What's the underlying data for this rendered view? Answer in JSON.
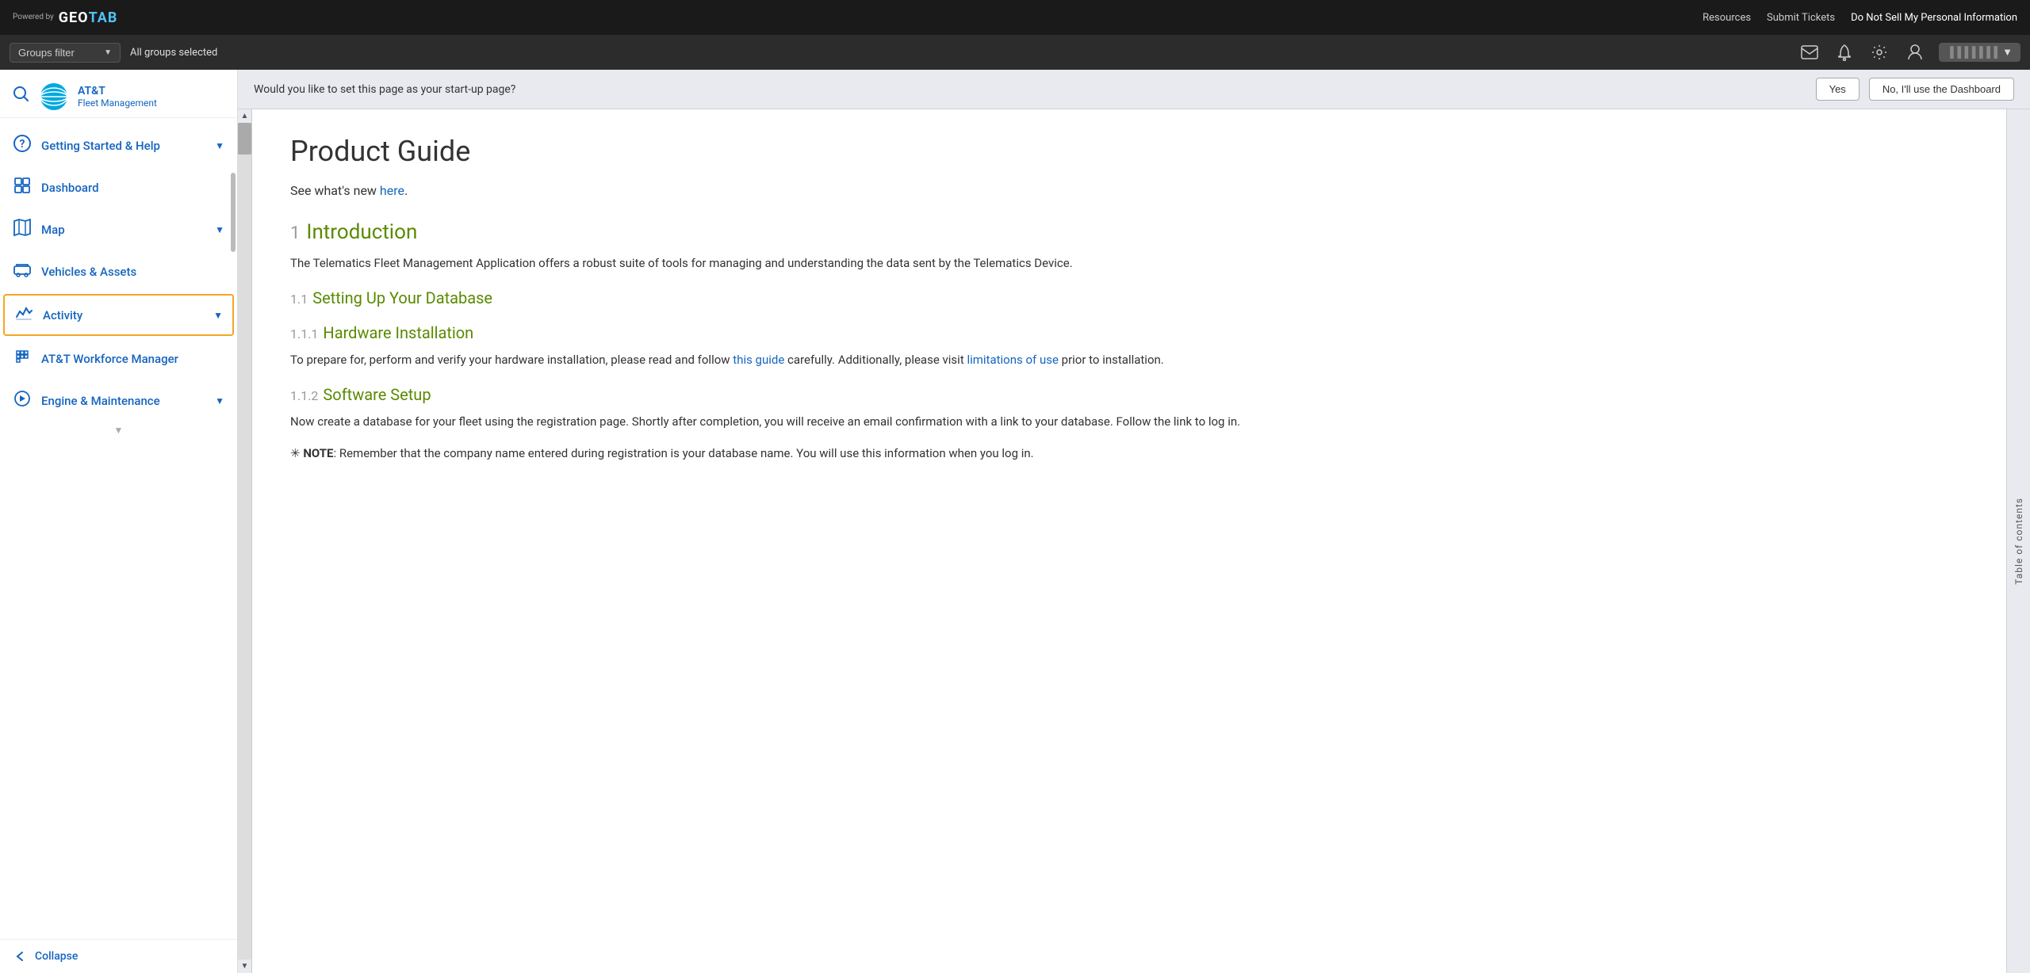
{
  "topbar": {
    "powered_by": "Powered\nby",
    "logo_geo": "GEO",
    "logo_tab": "TAB",
    "nav_links": [
      {
        "label": "Resources",
        "id": "resources"
      },
      {
        "label": "Submit Tickets",
        "id": "submit-tickets"
      },
      {
        "label": "Do Not Sell My Personal Information",
        "id": "do-not-sell"
      }
    ]
  },
  "groups_bar": {
    "filter_label": "Groups filter",
    "all_groups": "All groups selected"
  },
  "sidebar": {
    "company_name": "AT&T",
    "company_sub": "Fleet Management",
    "nav_items": [
      {
        "id": "getting-started",
        "label": "Getting Started & Help",
        "icon": "❓",
        "has_chevron": true,
        "active": false
      },
      {
        "id": "dashboard",
        "label": "Dashboard",
        "icon": "📊",
        "has_chevron": false,
        "active": false
      },
      {
        "id": "map",
        "label": "Map",
        "icon": "🗺",
        "has_chevron": true,
        "active": false
      },
      {
        "id": "vehicles",
        "label": "Vehicles & Assets",
        "icon": "🚛",
        "has_chevron": false,
        "active": false
      },
      {
        "id": "activity",
        "label": "Activity",
        "icon": "📈",
        "has_chevron": true,
        "active": true
      },
      {
        "id": "workforce",
        "label": "AT&T Workforce Manager",
        "icon": "🧩",
        "has_chevron": false,
        "active": false
      },
      {
        "id": "engine",
        "label": "Engine & Maintenance",
        "icon": "🎥",
        "has_chevron": true,
        "active": false
      }
    ],
    "collapse_label": "Collapse"
  },
  "startup_bar": {
    "question": "Would you like to set this page as your start-up page?",
    "yes_label": "Yes",
    "no_label": "No, I'll use the Dashboard"
  },
  "doc": {
    "title": "Product Guide",
    "subtitle_text": "See what's new ",
    "subtitle_link": "here",
    "subtitle_period": ".",
    "sections": [
      {
        "num": "1",
        "title": "Introduction",
        "body": "The Telematics Fleet Management Application offers a robust suite of tools for managing and understanding the data sent by the Telematics Device.",
        "subsections": [
          {
            "num": "1.1",
            "title": "Setting Up Your Database",
            "subsections": [
              {
                "num": "1.1.1",
                "title": "Hardware Installation",
                "body_before": "To prepare for, perform and verify your hardware installation, please read and follow ",
                "link1_text": "this guide",
                "body_mid": " carefully. Additionally, please visit ",
                "link2_text": "limitations of use",
                "body_after": " prior to installation."
              },
              {
                "num": "1.1.2",
                "title": "Software Setup",
                "body": "Now create a database for your fleet using the registration page. Shortly after completion, you will receive an email confirmation with a link to your database. Follow the link to log in."
              }
            ]
          }
        ]
      }
    ],
    "note_symbol": "✳",
    "note_label": "NOTE",
    "note_text": ": Remember that the company name entered during registration is your database name. You will use this information when you log in.",
    "toc_label": "Table of contents"
  }
}
